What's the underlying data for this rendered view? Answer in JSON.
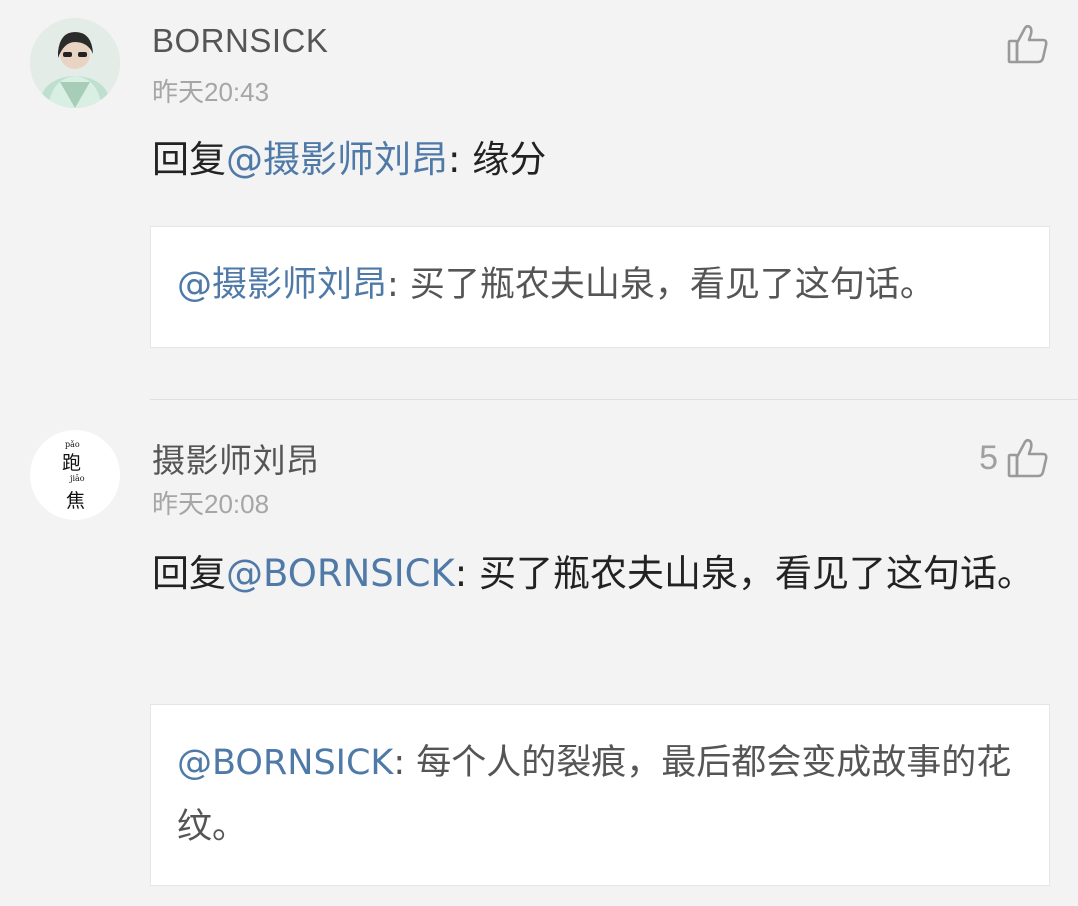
{
  "comments": [
    {
      "username": "BORNSICK",
      "time": "昨天20:43",
      "like_count": "",
      "reply_prefix": "回复",
      "reply_mention": "@摄影师刘昂",
      "reply_body": ": 缘分",
      "quote_mention": "@摄影师刘昂",
      "quote_body": ": 买了瓶农夫山泉，看见了这句话。"
    },
    {
      "username": "摄影师刘昂",
      "time": "昨天20:08",
      "like_count": "5",
      "reply_prefix": "回复",
      "reply_mention": "@BORNSICK",
      "reply_body": ": 买了瓶农夫山泉，看见了这句话。",
      "quote_mention": "@BORNSICK",
      "quote_body": ": 每个人的裂痕，最后都会变成故事的花纹。",
      "avatar_text": {
        "pinyin_top": "pǎo",
        "char_top": "跑",
        "pinyin_bottom": "jiāo",
        "char_bottom": "焦"
      }
    }
  ],
  "icons": {
    "like": "thumbs-up-icon"
  },
  "colors": {
    "mention": "#4f7aa8",
    "background": "#f3f3f3",
    "muted": "#a6a6a6"
  }
}
